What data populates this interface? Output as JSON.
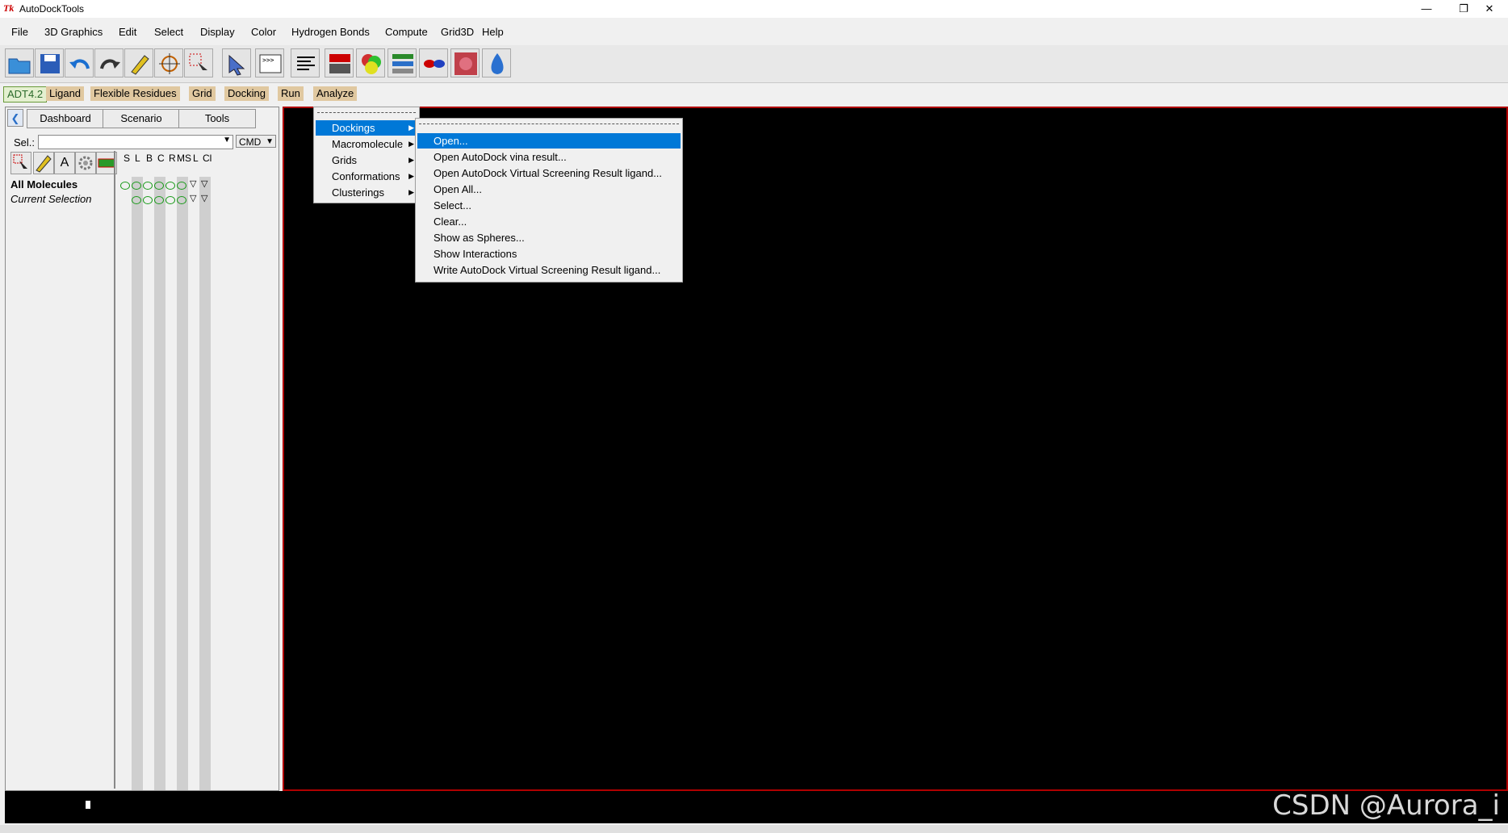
{
  "window": {
    "app_icon": "Tk",
    "title": "AutoDockTools",
    "min": "—",
    "restore": "❐",
    "close": "✕"
  },
  "menubar": [
    "File",
    "3D Graphics",
    "Edit",
    "Select",
    "Display",
    "Color",
    "Hydrogen Bonds",
    "Compute",
    "Grid3D",
    "Help"
  ],
  "adt_menubar": [
    "ADT4.2",
    "Ligand",
    "Flexible Residues",
    "Grid",
    "Docking",
    "Run",
    "Analyze"
  ],
  "left_panel": {
    "tabs": [
      "Dashboard",
      "Scenario",
      "Tools"
    ],
    "sel_label": "Sel.:",
    "sel_value": "",
    "cmd_label": "CMD",
    "column_headers": [
      "S",
      "L",
      "B",
      "C",
      "R",
      "MS",
      "L",
      "Cl"
    ],
    "rows": [
      {
        "label": "All Molecules"
      },
      {
        "label": "Current Selection"
      }
    ]
  },
  "analyze_menu": {
    "items": [
      "Dockings",
      "Macromolecule",
      "Grids",
      "Conformations",
      "Clusterings"
    ],
    "highlighted": "Dockings"
  },
  "dockings_submenu": {
    "items": [
      "Open...",
      "Open AutoDock vina result...",
      "Open AutoDock Virtual Screening Result ligand...",
      "Open All...",
      "Select...",
      "Clear...",
      "Show as Spheres...",
      "Show Interactions",
      "Write AutoDock Virtual Screening Result ligand..."
    ],
    "highlighted": "Open..."
  },
  "watermark": "CSDN @Aurora_i",
  "colors": {
    "highlight": "#0078d7",
    "viewer_border": "#b00000",
    "adt_tab": "#e0c8a0"
  }
}
